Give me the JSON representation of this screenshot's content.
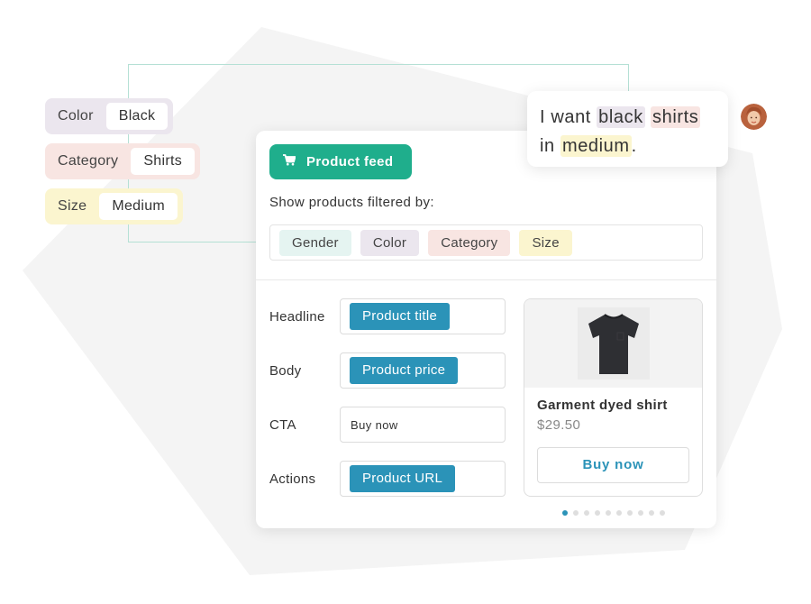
{
  "colors": {
    "accent_green": "#1fae8c",
    "token_blue": "#2b93b8",
    "gender_bg": "#e5f4f1",
    "color_bg": "#ebe6ee",
    "category_bg": "#f8e5e2",
    "size_bg": "#fbf5cf",
    "background_shape": "#f4f4f4",
    "connector_line": "#b5e0d5"
  },
  "extracted_attributes": [
    {
      "label": "Color",
      "value": "Black",
      "color": "#ebe6ee"
    },
    {
      "label": "Category",
      "value": "Shirts",
      "color": "#f8e5e2"
    },
    {
      "label": "Size",
      "value": "Medium",
      "color": "#fbf5cf"
    }
  ],
  "feed_button": {
    "label": "Product feed",
    "icon": "shopping-cart-icon"
  },
  "filter": {
    "title": "Show products filtered by:",
    "pills": [
      {
        "label": "Gender",
        "color": "#e5f4f1"
      },
      {
        "label": "Color",
        "color": "#ebe6ee"
      },
      {
        "label": "Category",
        "color": "#f8e5e2"
      },
      {
        "label": "Size",
        "color": "#fbf5cf"
      }
    ]
  },
  "fields": [
    {
      "label": "Headline",
      "token": "Product title",
      "kind": "token"
    },
    {
      "label": "Body",
      "token": "Product price",
      "kind": "token"
    },
    {
      "label": "CTA",
      "token": "Buy now",
      "kind": "text"
    },
    {
      "label": "Actions",
      "token": "Product URL",
      "kind": "token"
    }
  ],
  "preview": {
    "image": "black-tshirt",
    "title": "Garment dyed shirt",
    "price": "$29.50",
    "button": "Buy now"
  },
  "carousel": {
    "count": 10,
    "active": 0
  },
  "chat": {
    "w1": "I want ",
    "w2": "black",
    "w3": " ",
    "w4": "shirts",
    "w5": "in ",
    "w6": "medium",
    "w7": "."
  },
  "avatar": {
    "icon": "user-avatar"
  }
}
